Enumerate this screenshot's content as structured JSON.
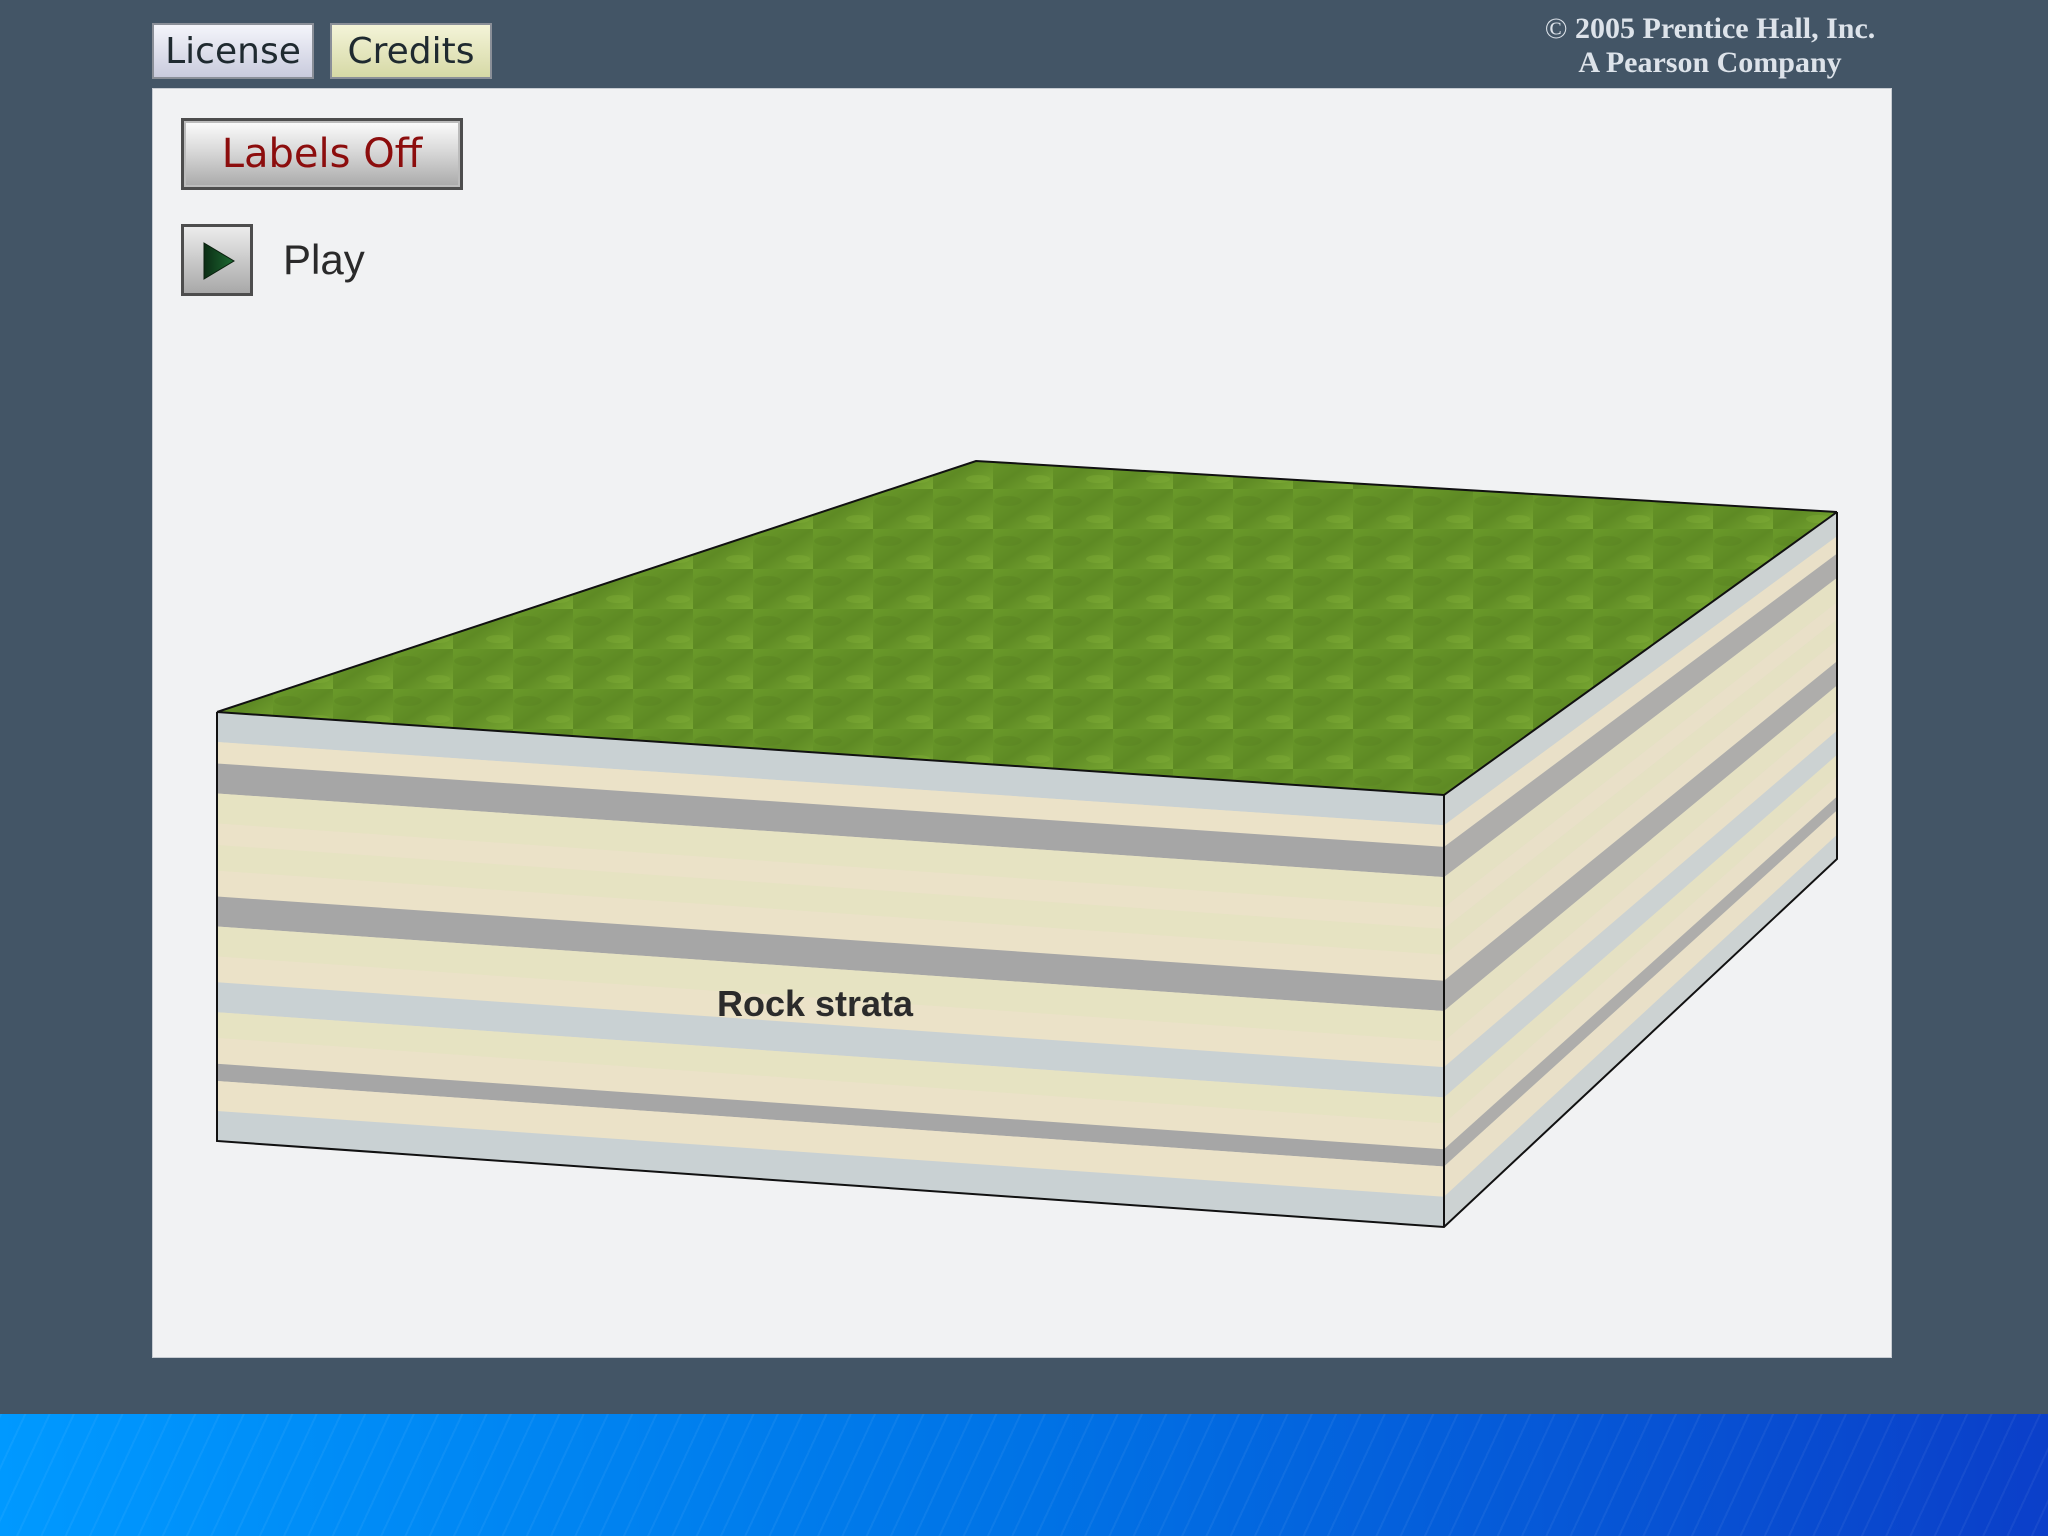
{
  "toolbar": {
    "license_label": "License",
    "credits_label": "Credits"
  },
  "copyright": {
    "symbol": "©",
    "line1": "2005 Prentice Hall, Inc.",
    "line2": "A Pearson Company"
  },
  "controls": {
    "labels_toggle": "Labels Off",
    "play_label": "Play",
    "play_icon": "play-triangle"
  },
  "diagram": {
    "front_label": "Rock strata",
    "colors": {
      "ground": "#6f9a2c",
      "stripe_gray": "#a6a6a6",
      "stripe_beige": "#ebe2c8",
      "stripe_cream": "#e6e3c2",
      "stripe_blue": "#c9d1d3",
      "edge": "#111111"
    }
  },
  "colors": {
    "background": "#435566",
    "stage": "#f1f2f3",
    "labels_text": "#8c0d0d",
    "footer_start": "#0099ff",
    "footer_end": "#0b3fc9"
  }
}
